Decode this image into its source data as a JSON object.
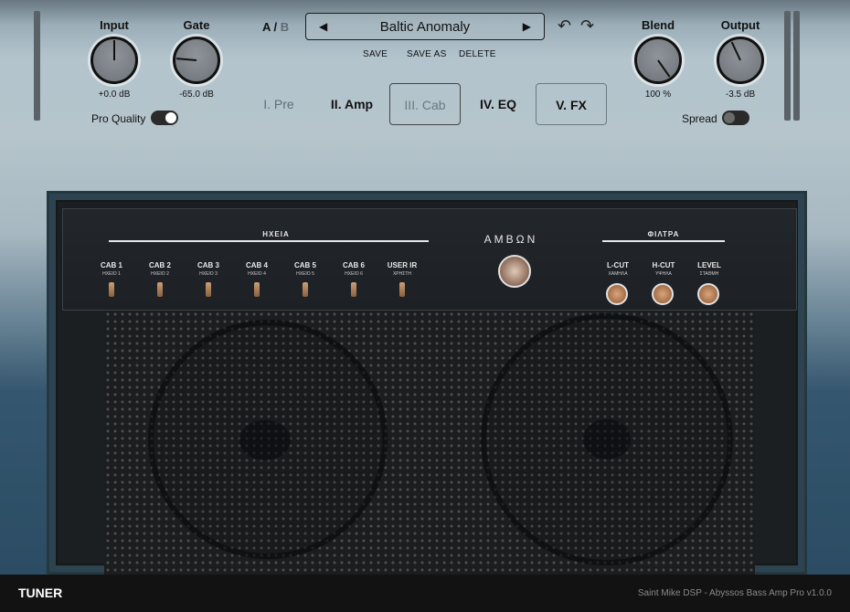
{
  "header": {
    "input": {
      "label": "Input",
      "value": "+0.0 dB"
    },
    "gate": {
      "label": "Gate",
      "value": "-65.0 dB"
    },
    "pro_quality": {
      "label": "Pro Quality",
      "on": true
    },
    "ab": {
      "a": "A",
      "sep": "/",
      "b": "B"
    },
    "preset": {
      "name": "Baltic Anomaly",
      "prev": "◀",
      "next": "▶"
    },
    "actions": {
      "save": "SAVE",
      "save_as": "SAVE AS",
      "delete": "DELETE"
    },
    "undo": "↶",
    "redo": "↷",
    "blend": {
      "label": "Blend",
      "value": "100 %"
    },
    "output": {
      "label": "Output",
      "value": "-3.5 dB"
    },
    "spread": {
      "label": "Spread",
      "on": false
    }
  },
  "tabs": [
    {
      "label": "I. Pre"
    },
    {
      "label": "II. Amp"
    },
    {
      "label": "III. Cab"
    },
    {
      "label": "IV. EQ"
    },
    {
      "label": "V. FX"
    }
  ],
  "cab_panel": {
    "section_title": "ΗΧΕΙΑ",
    "brand": "ΑΜΒΩΝ",
    "filters_title": "ΦΙΛΤΡΑ",
    "switches": [
      {
        "label": "CAB 1",
        "sub": "ΗΧΕΙΟ 1"
      },
      {
        "label": "CAB 2",
        "sub": "ΗΧΕΙΟ 2"
      },
      {
        "label": "CAB 3",
        "sub": "ΗΧΕΙΟ 3"
      },
      {
        "label": "CAB 4",
        "sub": "ΗΧΕΙΟ 4"
      },
      {
        "label": "CAB 5",
        "sub": "ΗΧΕΙΟ 5"
      },
      {
        "label": "CAB 6",
        "sub": "ΗΧΕΙΟ 6"
      },
      {
        "label": "USER IR",
        "sub": "ΧΡΗΣΤΗ"
      }
    ],
    "filters": [
      {
        "label": "L-CUT",
        "sub": "ΧΑΜΗΛΑ"
      },
      {
        "label": "H-CUT",
        "sub": "ΥΨΗΛΑ"
      },
      {
        "label": "LEVEL",
        "sub": "ΣΤΑΘΜΗ"
      }
    ]
  },
  "footer": {
    "tuner": "TUNER",
    "credit": "Saint Mike DSP - Abyssos Bass Amp Pro v1.0.0"
  }
}
